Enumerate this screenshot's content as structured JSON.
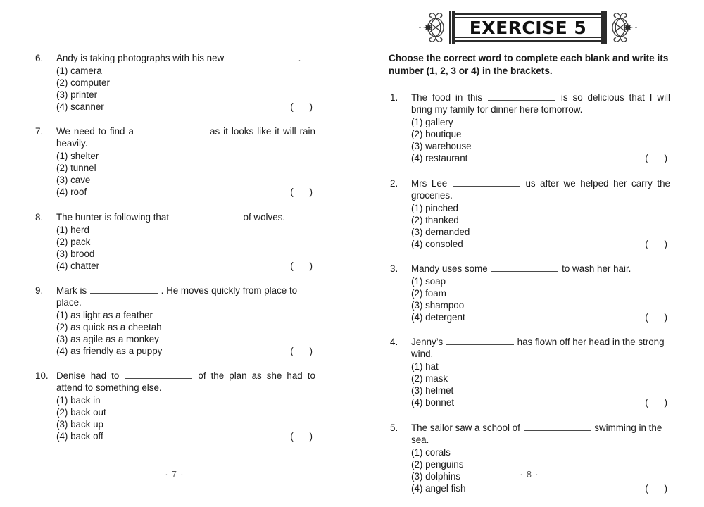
{
  "header": {
    "banner_title": "EXERCISE 5"
  },
  "left_column": {
    "page_number": "· 7 ·",
    "questions": [
      {
        "number": "6.",
        "stem_before": "Andy is taking photographs with his new",
        "stem_after": ".",
        "multiline": false,
        "options": [
          "(1) camera",
          "(2) computer",
          "(3) printer",
          "(4) scanner"
        ],
        "brackets": "(      )"
      },
      {
        "number": "7.",
        "stem_before": "We need to find a",
        "stem_after": "as it looks like it will rain heavily.",
        "multiline": true,
        "options": [
          "(1) shelter",
          "(2) tunnel",
          "(3) cave",
          "(4) roof"
        ],
        "brackets": "(      )"
      },
      {
        "number": "8.",
        "stem_before": "The hunter is following that",
        "stem_after": "of wolves.",
        "multiline": false,
        "options": [
          "(1) herd",
          "(2) pack",
          "(3) brood",
          "(4) chatter"
        ],
        "brackets": "(      )"
      },
      {
        "number": "9.",
        "stem_before": "Mark is",
        "stem_after": ". He moves quickly from place to place.",
        "multiline": false,
        "options": [
          "(1) as light as a feather",
          "(2) as quick as a cheetah",
          "(3) as agile as a monkey",
          "(4) as friendly as a puppy"
        ],
        "brackets": "(      )"
      },
      {
        "number": "10.",
        "stem_before": "Denise had to",
        "stem_after": "of the plan as she had to attend to something else.",
        "multiline": true,
        "options": [
          "(1) back in",
          "(2) back out",
          "(3) back up",
          "(4) back off"
        ],
        "brackets": "(      )"
      }
    ]
  },
  "right_column": {
    "page_number": "· 8 ·",
    "instructions": "Choose the correct word to complete each blank and write its number (1, 2, 3 or 4) in the brackets.",
    "questions": [
      {
        "number": "1.",
        "stem_before": "The food in this",
        "stem_after": "is so delicious that I will bring my family for dinner here tomorrow.",
        "multiline": true,
        "options": [
          "(1) gallery",
          "(2) boutique",
          "(3) warehouse",
          "(4) restaurant"
        ],
        "brackets": "(      )"
      },
      {
        "number": "2.",
        "stem_before": "Mrs Lee",
        "stem_after": "us after we helped her carry the groceries.",
        "multiline": true,
        "options": [
          "(1) pinched",
          "(2) thanked",
          "(3) demanded",
          "(4) consoled"
        ],
        "brackets": "(      )"
      },
      {
        "number": "3.",
        "stem_before": "Mandy uses some",
        "stem_after": "to wash her hair.",
        "multiline": false,
        "options": [
          "(1) soap",
          "(2) foam",
          "(3) shampoo",
          "(4) detergent"
        ],
        "brackets": "(      )"
      },
      {
        "number": "4.",
        "stem_before": "Jenny’s",
        "stem_after": "has flown off her head in the strong wind.",
        "multiline": false,
        "options": [
          "(1) hat",
          "(2) mask",
          "(3) helmet",
          "(4) bonnet"
        ],
        "brackets": "(      )"
      },
      {
        "number": "5.",
        "stem_before": "The sailor saw a school of",
        "stem_after": "swimming in the sea.",
        "multiline": false,
        "options": [
          "(1) corals",
          "(2) penguins",
          "(3) dolphins",
          "(4) angel fish"
        ],
        "brackets": "(      )"
      }
    ]
  },
  "colors": {
    "text": "#1a1a1a",
    "rule": "#4a4a4a",
    "banner": "#2b2b2b",
    "page_number": "#555555",
    "background": "#ffffff"
  }
}
